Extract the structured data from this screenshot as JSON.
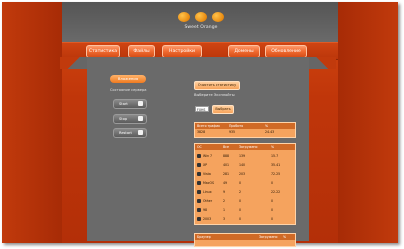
{
  "site": {
    "name": "Sweet Orange"
  },
  "nav": [
    "Статистика",
    "Файлы",
    "Настройки",
    "Домены",
    "Обновление"
  ],
  "sidebar": {
    "header": "Вложения",
    "title": "Состояние сервера",
    "buttons": [
      "Start",
      "Stop",
      "Restart"
    ]
  },
  "main": {
    "clear_button": "Очистить статистику",
    "section_label": "Выберите Эксплойты",
    "select_value": "FXHS",
    "select_button": "Выбрать",
    "summary": {
      "headers": [
        "Всего трафик",
        "Пробито",
        "%"
      ],
      "row": [
        "3828",
        "935",
        "24.43"
      ]
    },
    "os_table": {
      "headers": [
        "OC",
        "Все",
        "Загружено",
        "%"
      ],
      "rows": [
        [
          "Win 7",
          "888",
          "139",
          "15.7"
        ],
        [
          "XP",
          "401",
          "140",
          "35.41"
        ],
        [
          "Vista",
          "281",
          "203",
          "72.25"
        ],
        [
          "MacOS",
          "49",
          "0",
          "0"
        ],
        [
          "Linux",
          "9",
          "2",
          "22.22"
        ],
        [
          "Other",
          "2",
          "0",
          "0"
        ],
        [
          "98",
          "1",
          "0",
          "0"
        ],
        [
          "2003",
          "3",
          "0",
          "0"
        ]
      ]
    },
    "browser_table": {
      "headers": [
        "Браузер",
        "Загружено",
        "%"
      ]
    }
  },
  "colors": {
    "accent": "#f07a20",
    "background": "#c0360a",
    "panel": "#6a6a6a"
  }
}
